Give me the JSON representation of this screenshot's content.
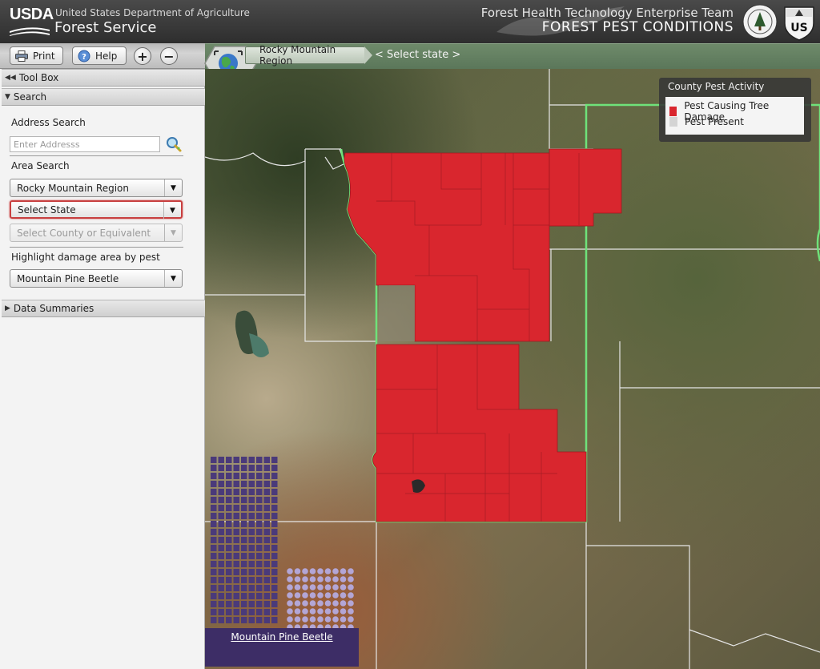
{
  "header": {
    "logo_text": "USDA",
    "department": "United States Department of Agriculture",
    "agency": "Forest Service",
    "team": "Forest Health Technology Enterprise Team",
    "title": "FOREST PEST CONDITIONS",
    "seal_right_text": "US"
  },
  "toolbar": {
    "print_label": "Print",
    "help_label": "Help",
    "zoom_in_label": "+",
    "zoom_out_label": "−"
  },
  "breadcrumb": {
    "region": "Rocky Mountain Region",
    "state": "< Select state >"
  },
  "left_panel": {
    "toolbox_label": "Tool Box",
    "search_label": "Search",
    "address_search_label": "Address Search",
    "address_placeholder": "Enter Addresss",
    "area_search_label": "Area Search",
    "region_value": "Rocky Mountain Region",
    "state_value": "Select State",
    "county_value": "Select County or Equivalent",
    "highlight_label": "Highlight damage area by pest",
    "pest_value": "Mountain Pine Beetle",
    "data_summaries_label": "Data Summaries"
  },
  "legend": {
    "title": "County Pest Activity",
    "items": [
      {
        "label": "Pest Causing Tree Damage",
        "color": "#d9262e"
      },
      {
        "label": "Pest Present",
        "color": "#d4d4d4"
      }
    ]
  },
  "pest_thumbnail": {
    "link": "Mountain Pine Beetle"
  },
  "colors": {
    "header_bg": "#3a3a3a",
    "crumb_bar": "#637f61",
    "region_border": "#6fe27a",
    "damage_fill": "#d9262e",
    "thumb_purple": "#3d2d66"
  },
  "icons": {
    "print": "printer-icon",
    "help": "help-icon",
    "zoom_in": "plus-icon",
    "zoom_out": "minus-icon",
    "globe": "globe-icon",
    "search": "magnifier-icon"
  }
}
